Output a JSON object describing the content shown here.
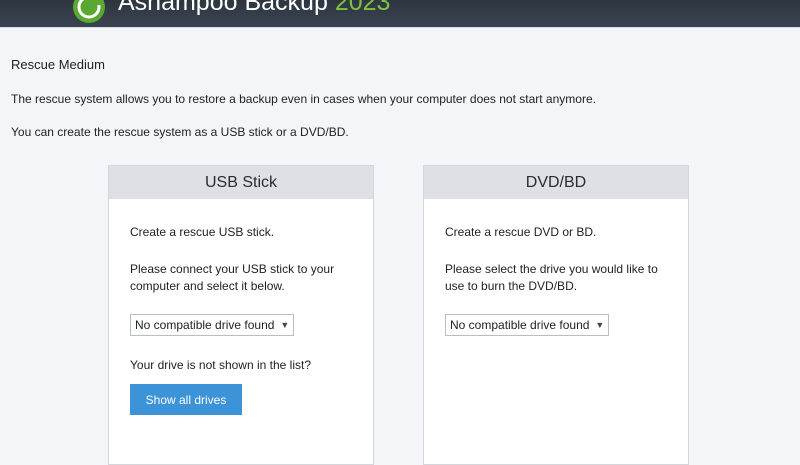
{
  "app": {
    "title_main": "Ashampoo Backup",
    "title_year": "2023"
  },
  "page": {
    "heading": "Rescue Medium",
    "description": "The rescue system allows you to restore a backup even in cases when your computer does not start anymore.",
    "hint": "You can create the rescue system as a USB stick or a DVD/BD."
  },
  "usb": {
    "title": "USB Stick",
    "line1": "Create a rescue USB stick.",
    "line2": "Please connect your USB stick to your computer and select it below.",
    "dropdown_value": "No compatible drive found",
    "missing_text": "Your drive is not shown in the list?",
    "button_label": "Show all drives"
  },
  "dvd": {
    "title": "DVD/BD",
    "line1": "Create a rescue DVD or BD.",
    "line2": "Please select the drive you would like to use to burn the DVD/BD.",
    "dropdown_value": "No compatible drive found"
  },
  "icons": {
    "logo": "ashampoo-backup-logo-icon",
    "dropdown": "chevron-down-icon"
  },
  "colors": {
    "accent": "#3d93d8",
    "titlebar": "#2d3540",
    "brand_green": "#7fc242"
  }
}
